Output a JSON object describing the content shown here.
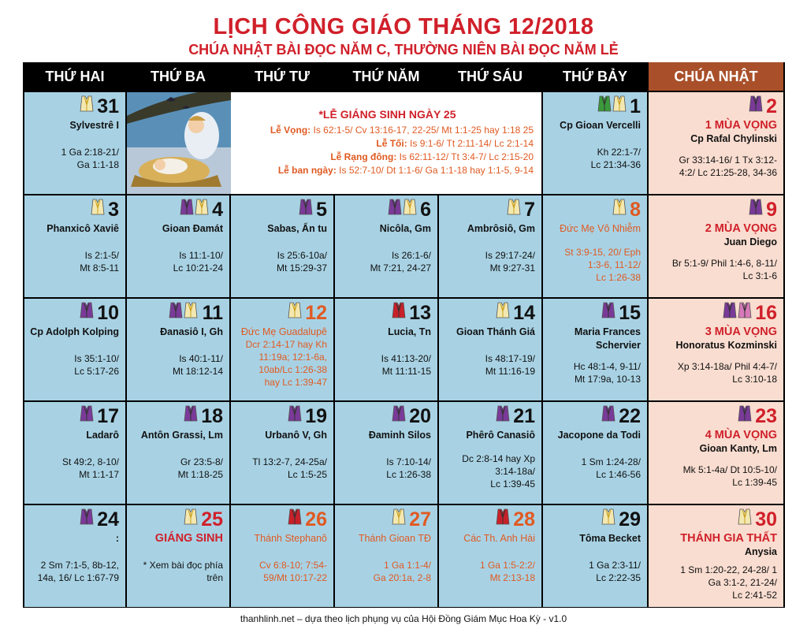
{
  "title": "LỊCH CÔNG GIÁO THÁNG 12/2018",
  "subtitle": "CHÚA NHẬT BÀI ĐỌC NĂM C, THƯỜNG NIÊN BÀI ĐỌC NĂM LẺ",
  "weekdays": [
    "THỨ HAI",
    "THỨ BA",
    "THỨ TƯ",
    "THỨ NĂM",
    "THỨ SÁU",
    "THỨ BẢY",
    "CHÚA NHẬT"
  ],
  "colors": {
    "white": "#f3e8b0",
    "purple": "#7a3a98",
    "red": "#c8202a",
    "green": "#3a9a3a",
    "rose": "#d77ab8",
    "red_text": "#d0202a",
    "orange_text": "#e05a22"
  },
  "christmas": {
    "title": "*LỄ GIÁNG SINH NGÀY 25",
    "lines": [
      {
        "label": "Lễ Vọng:",
        "text": " Is 62:1-5/ Cv 13:16-17, 22-25/ Mt 1:1-25 hay 1:18 25"
      },
      {
        "label": "Lễ Tối:",
        "text": " Is 9:1-6/ Tt 2:11-14/ Lc 2:1-14"
      },
      {
        "label": "Lễ Rạng đông:",
        "text": " Is 62:11-12/ Tt 3:4-7/ Lc 2:15-20"
      },
      {
        "label": "Lễ ban ngày:",
        "text": " Is 52:7-10/ Dt 1:1-6/ Ga 1:1-18 hay 1:1-5, 9-14"
      }
    ]
  },
  "days": [
    {
      "num": "31",
      "vest": [
        "white"
      ],
      "saint": "Sylvestrê I",
      "reading": [
        "1 Ga 2:18-21/",
        "Ga 1:1-18"
      ]
    },
    {
      "num": "1",
      "vest": [
        "green",
        "white"
      ],
      "saint": "Cp Gioan Vercelli",
      "reading": [
        "Kh 22:1-7/",
        "Lc 21:34-36"
      ]
    },
    {
      "num": "2",
      "vest": [
        "purple"
      ],
      "saint": "1 MÙA VỌNG",
      "saint2": "Cp Rafal Chylinski",
      "reading": [
        "Gr 33:14-16/ 1 Tx 3:12-",
        "4:2/ Lc 21:25-28, 34-36"
      ]
    },
    {
      "num": "3",
      "vest": [
        "white"
      ],
      "saint": "Phanxicô Xaviê",
      "reading": [
        "Is 2:1-5/",
        "Mt 8:5-11"
      ]
    },
    {
      "num": "4",
      "vest": [
        "purple",
        "white"
      ],
      "saint": "Gioan Đamát",
      "reading": [
        "Is 11:1-10/",
        "Lc 10:21-24"
      ]
    },
    {
      "num": "5",
      "vest": [
        "purple"
      ],
      "saint": "Sabas, Ẩn tu",
      "reading": [
        "Is 25:6-10a/",
        "Mt 15:29-37"
      ]
    },
    {
      "num": "6",
      "vest": [
        "purple",
        "white"
      ],
      "saint": "Nicôla, Gm",
      "reading": [
        "Is 26:1-6/",
        "Mt 7:21, 24-27"
      ]
    },
    {
      "num": "7",
      "vest": [
        "white"
      ],
      "saint": "Ambrôsiô, Gm",
      "reading": [
        "Is 29:17-24/",
        "Mt 9:27-31"
      ]
    },
    {
      "num": "8",
      "vest": [
        "white"
      ],
      "saint": "Đức Mẹ Vô Nhiễm",
      "reading": [
        "St 3:9-15, 20/ Eph",
        "1:3-6, 11-12/",
        "Lc 1:26-38"
      ]
    },
    {
      "num": "9",
      "vest": [
        "purple"
      ],
      "saint": "2 MÙA VỌNG",
      "saint2": "Juan Diego",
      "reading": [
        "Br 5:1-9/ Phil 1:4-6, 8-11/",
        "Lc 3:1-6"
      ]
    },
    {
      "num": "10",
      "vest": [
        "purple"
      ],
      "saint": "Cp Adolph Kolping",
      "reading": [
        "Is 35:1-10/",
        "Lc 5:17-26"
      ]
    },
    {
      "num": "11",
      "vest": [
        "purple",
        "white"
      ],
      "saint": "Đanasiô I, Gh",
      "reading": [
        "Is 40:1-11/",
        "Mt 18:12-14"
      ]
    },
    {
      "num": "12",
      "vest": [
        "white"
      ],
      "saint": "Đức Mẹ Guadalupê",
      "reading": [
        "Dcr 2:14-17 hay Kh",
        "11:19a; 12:1-6a,",
        "10ab/Lc 1:26-38",
        "hay Lc 1:39-47"
      ]
    },
    {
      "num": "13",
      "vest": [
        "red"
      ],
      "saint": "Lucia, Tn",
      "reading": [
        "Is 41:13-20/",
        "Mt 11:11-15"
      ]
    },
    {
      "num": "14",
      "vest": [
        "white"
      ],
      "saint": "Gioan Thánh Giá",
      "reading": [
        "Is 48:17-19/",
        "Mt 11:16-19"
      ]
    },
    {
      "num": "15",
      "vest": [
        "purple"
      ],
      "saint": "Maria Frances",
      "saint2": "Schervier",
      "reading": [
        "Hc 48:1-4, 9-11/",
        "Mt 17:9a, 10-13"
      ]
    },
    {
      "num": "16",
      "vest": [
        "purple",
        "rose"
      ],
      "saint": "3 MÙA VỌNG",
      "saint2": "Honoratus Kozminski",
      "reading": [
        "Xp 3:14-18a/ Phil 4:4-7/",
        "Lc 3:10-18"
      ]
    },
    {
      "num": "17",
      "vest": [
        "purple"
      ],
      "saint": "Ladarô",
      "reading": [
        "St 49:2, 8-10/",
        "Mt 1:1-17"
      ]
    },
    {
      "num": "18",
      "vest": [
        "purple"
      ],
      "saint": "Antôn Grassi, Lm",
      "reading": [
        "Gr 23:5-8/",
        "Mt 1:18-25"
      ]
    },
    {
      "num": "19",
      "vest": [
        "purple"
      ],
      "saint": "Urbanô V, Gh",
      "reading": [
        "Tl 13:2-7, 24-25a/",
        "Lc 1:5-25"
      ]
    },
    {
      "num": "20",
      "vest": [
        "purple"
      ],
      "saint": "Đaminh Silos",
      "reading": [
        "Is 7:10-14/",
        "Lc 1:26-38"
      ]
    },
    {
      "num": "21",
      "vest": [
        "purple"
      ],
      "saint": "Phêrô Canasiô",
      "reading": [
        "Dc 2:8-14 hay Xp",
        "3:14-18a/",
        "Lc 1:39-45"
      ]
    },
    {
      "num": "22",
      "vest": [
        "purple"
      ],
      "saint": "Jacopone da Todi",
      "reading": [
        "1 Sm 1:24-28/",
        "Lc 1:46-56"
      ]
    },
    {
      "num": "23",
      "vest": [
        "purple"
      ],
      "saint": "4 MÙA VỌNG",
      "saint2": "Gioan Kanty, Lm",
      "reading": [
        "Mk 5:1-4a/ Dt 10:5-10/",
        "Lc 1:39-45"
      ]
    },
    {
      "num": "24",
      "vest": [
        "purple"
      ],
      "saint": ":",
      "reading": [
        "2 Sm 7:1-5, 8b-12,",
        "14a, 16/ Lc 1:67-79"
      ]
    },
    {
      "num": "25",
      "vest": [
        "white"
      ],
      "saint": "GIÁNG SINH",
      "reading": [
        "* Xem bài đọc phía",
        "trên"
      ]
    },
    {
      "num": "26",
      "vest": [
        "red"
      ],
      "saint": "Thánh Stephanô",
      "reading": [
        "Cv 6:8-10; 7:54-",
        "59/Mt 10:17-22"
      ]
    },
    {
      "num": "27",
      "vest": [
        "white"
      ],
      "saint": "Thánh Gioan TĐ",
      "reading": [
        "1 Ga 1:1-4/",
        "Ga 20:1a, 2-8"
      ]
    },
    {
      "num": "28",
      "vest": [
        "red"
      ],
      "saint": "Các Th. Anh Hài",
      "reading": [
        "1 Ga 1:5-2:2/",
        "Mt 2:13-18"
      ]
    },
    {
      "num": "29",
      "vest": [
        "white"
      ],
      "saint": "Tôma Becket",
      "reading": [
        "1 Ga 2:3-11/",
        "Lc 2:22-35"
      ]
    },
    {
      "num": "30",
      "vest": [
        "white"
      ],
      "saint": "THÁNH GIA THẤT",
      "saint2": "Anysia",
      "reading": [
        "1 Sm 1:20-22, 24-28/ 1",
        "Ga 3:1-2, 21-24/",
        "Lc 2:41-52"
      ]
    }
  ],
  "footer": "thanhlinh.net – dựa theo lịch phụng vụ của Hội Đồng Giám Mục Hoa Kỳ - v1.0"
}
